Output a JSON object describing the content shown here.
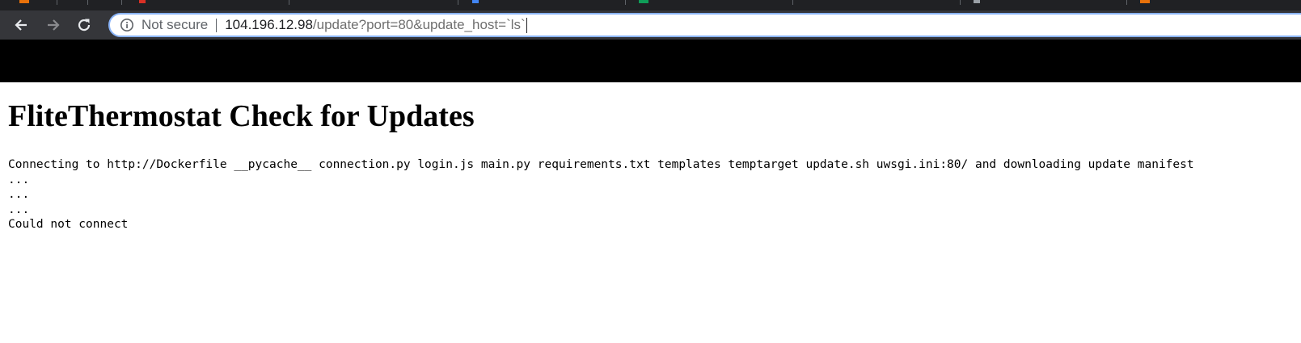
{
  "browser": {
    "address_bar": {
      "security_label": "Not secure",
      "url_host": "104.196.12.98",
      "url_path": "/update?port=80&update_host=`ls`"
    },
    "icons": [
      "back-arrow-icon",
      "forward-arrow-icon",
      "reload-icon",
      "info-icon"
    ],
    "colors": {
      "tabstrip": "#202124",
      "toolbar": "#35363a",
      "omnibox_focus_ring": "#8ab4f8"
    }
  },
  "page": {
    "title": "FliteThermostat Check for Updates",
    "output_lines": [
      "Connecting to http://Dockerfile __pycache__ connection.py login.js main.py requirements.txt templates temptarget update.sh uwsgi.ini:80/ and downloading update manifest",
      "...",
      "...",
      "...",
      "Could not connect"
    ],
    "colors": {
      "banner": "#000000",
      "background": "#ffffff",
      "text": "#000000"
    }
  }
}
